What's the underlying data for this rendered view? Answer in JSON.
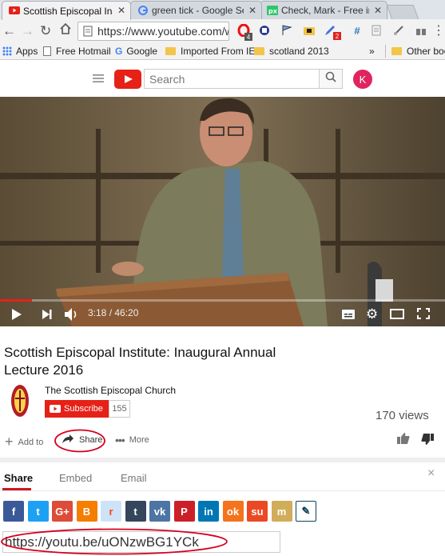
{
  "tabs": [
    {
      "label": "Scottish Episcopal Insti",
      "icon": "youtube-icon"
    },
    {
      "label": "green tick - Google Se",
      "icon": "google-icon"
    },
    {
      "label": "Check, Mark - Free ima",
      "icon": "pixabay-icon"
    }
  ],
  "address": {
    "url": "https://www.youtube.com/wa"
  },
  "extensions": {
    "badge_1": "4",
    "badge_2": "2"
  },
  "bookmarks": [
    {
      "label": "Apps"
    },
    {
      "label": "Free Hotmail"
    },
    {
      "label": "Google"
    },
    {
      "label": "Imported From IE"
    },
    {
      "label": "scotland 2013"
    },
    {
      "label": "»"
    },
    {
      "label": "Other boo"
    }
  ],
  "youtube": {
    "search_placeholder": "Search",
    "avatar_letter": "K"
  },
  "player": {
    "time": "3:18 / 46:20",
    "progress_fraction": 0.0712
  },
  "video": {
    "title": "Scottish Episcopal Institute: Inaugural Annual Lecture 2016",
    "channel": "The Scottish Episcopal Church",
    "subscribe_label": "Subscribe",
    "subscriber_count": "155",
    "views": "170 views"
  },
  "actions": {
    "add_to": "Add to",
    "share": "Share",
    "more": "More"
  },
  "share_panel": {
    "tabs": [
      "Share",
      "Embed",
      "Email"
    ],
    "close": "×",
    "short_url": "https://youtu.be/uONzwBG1YCk"
  },
  "social": [
    {
      "name": "facebook",
      "glyph": "f",
      "color": "#3b5998"
    },
    {
      "name": "twitter",
      "glyph": "t",
      "color": "#1da1f2"
    },
    {
      "name": "google-plus",
      "glyph": "G+",
      "color": "#dd4b39"
    },
    {
      "name": "blogger",
      "glyph": "B",
      "color": "#f57d00"
    },
    {
      "name": "reddit",
      "glyph": "r",
      "color": "#cee3f8"
    },
    {
      "name": "tumblr",
      "glyph": "t",
      "color": "#35465c"
    },
    {
      "name": "vk",
      "glyph": "vk",
      "color": "#4c75a3"
    },
    {
      "name": "pinterest",
      "glyph": "P",
      "color": "#cb2027"
    },
    {
      "name": "linkedin",
      "glyph": "in",
      "color": "#0077b5"
    },
    {
      "name": "odnoklassniki",
      "glyph": "ok",
      "color": "#f4731c"
    },
    {
      "name": "stumbleupon",
      "glyph": "su",
      "color": "#eb4924"
    },
    {
      "name": "mixi",
      "glyph": "m",
      "color": "#d1ad5a"
    },
    {
      "name": "livejournal",
      "glyph": "✎",
      "color": "#0d425a"
    }
  ],
  "colors": {
    "youtube_red": "#e62117",
    "annotation_red": "#d6001c",
    "link_blue": "#167ac6"
  }
}
